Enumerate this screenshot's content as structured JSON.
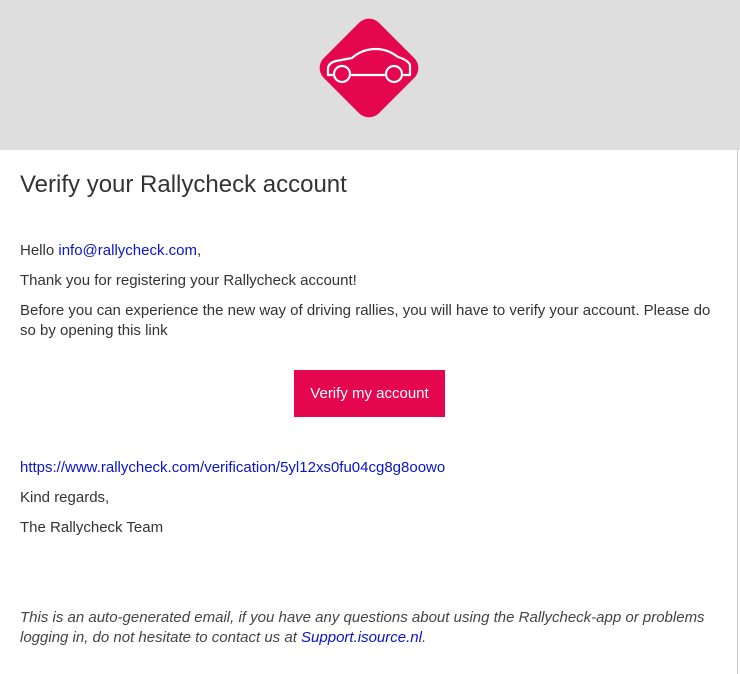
{
  "header": {
    "logo_icon": "car-icon",
    "brand_color": "#e4064f",
    "band_color": "#dedede"
  },
  "email": {
    "title": "Verify your Rallycheck account",
    "greeting_prefix": "Hello ",
    "greeting_email": "info@rallycheck.com",
    "greeting_suffix": ",",
    "thanks": "Thank you for registering your Rallycheck account!",
    "instructions": "Before you can experience the new way of driving rallies, you will have to verify your account. Please do so by opening this link",
    "button_label": "Verify my account",
    "verification_url": "https://www.rallycheck.com/verification/5yl12xs0fu04cg8g8oowo",
    "regards": "Kind regards,",
    "signature": "The Rallycheck Team",
    "footer_text": "This is an auto-generated email, if you have any questions about using the Rallycheck-app or problems logging in, do not hesitate to contact us at ",
    "footer_link": "Support.isource.nl",
    "footer_end": "."
  },
  "colors": {
    "link": "#0a14c8",
    "text": "#333333"
  }
}
